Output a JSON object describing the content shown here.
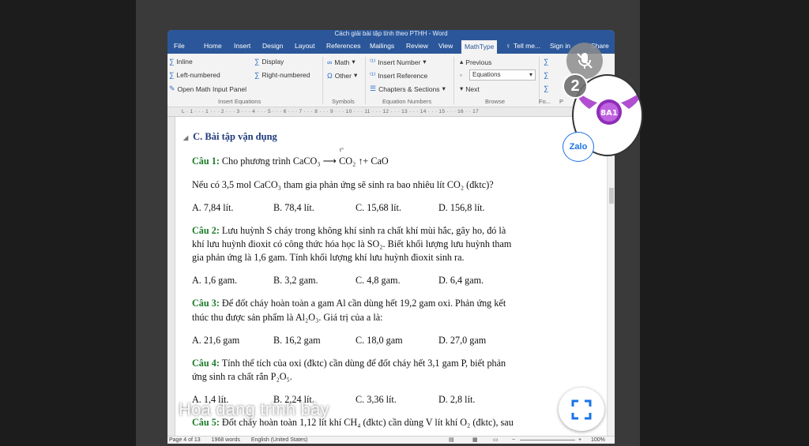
{
  "app": {
    "window_title": "Cách giải bài tập tính theo PTHH - Word"
  },
  "ribbon_tabs": [
    "File",
    "Home",
    "Insert",
    "Design",
    "Layout",
    "References",
    "Mailings",
    "Review",
    "View",
    "MathType",
    "Tell me...",
    "Sign in",
    "Share"
  ],
  "ribbon": {
    "insert_equations": {
      "inline": "Inline",
      "display": "Display",
      "left_numbered": "Left-numbered",
      "right_numbered": "Right-numbered",
      "open_panel": "Open Math Input Panel",
      "group_label": "Insert Equations"
    },
    "symbols": {
      "math": "Math",
      "other": "Other",
      "group_label": "Symbols"
    },
    "equation_numbers": {
      "insert_number": "Insert Number",
      "insert_reference": "Insert Reference",
      "chapters_sections": "Chapters & Sections",
      "group_label": "Equation Numbers"
    },
    "browse": {
      "previous": "Previous",
      "equations_value": "Equations",
      "next": "Next",
      "group_label": "Browse"
    },
    "fo_label": "Fo...",
    "p_label": "P"
  },
  "ruler_text": "L · 1 · · · 1 · · · 2 · · · 3 · · · 4 · · · 5 · · · 6 · · · 7 · · · 8 · · · 9 · · · 10 · · · 11 · · · 12 · · · 13 · · · 14 · · · 15 · · · 16 · · 17",
  "document": {
    "heading": "C. Bài tập vận dụng",
    "q1": {
      "label": "Câu 1:",
      "text": " Cho phương trình CaCO₃ ⟶ CO₂ ↑+ CaO",
      "arrow_note": "t°",
      "line2": "Nếu có 3,5 mol CaCO₃ tham gia phản ứng sẽ sinh ra bao nhiêu lít CO₂ (đktc)?",
      "options": [
        "A. 7,84 lít.",
        "B. 78,4 lít.",
        "C. 15,68 lít.",
        "D. 156,8 lít."
      ]
    },
    "q2": {
      "label": "Câu 2:",
      "line1": " Lưu huỳnh S cháy trong không khí sinh ra chất khí mùi hắc, gây ho, đó là",
      "line2": "khí lưu huỳnh đioxit có công thức hóa học là SO₂. Biết khối lượng lưu huỳnh tham",
      "line3": "gia phản ứng là 1,6 gam. Tính khối lượng khí lưu huỳnh đioxit sinh ra.",
      "options": [
        "A. 1,6 gam.",
        "B. 3,2 gam.",
        "C. 4,8 gam.",
        "D. 6,4 gam."
      ]
    },
    "q3": {
      "label": "Câu 3:",
      "line1": " Để đốt cháy hoàn toàn a gam Al cần dùng hết 19,2 gam oxi. Phản ứng kết",
      "line2": "thúc thu được sản phẩm là Al₂O₃. Giá trị của a là:",
      "options": [
        "A. 21,6 gam",
        "B. 16,2 gam",
        "C. 18,0 gam",
        "D. 27,0 gam"
      ]
    },
    "q4": {
      "label": "Câu 4:",
      "line1": " Tính thể tích của oxi (đktc) cần dùng để đốt cháy hết 3,1 gam P, biết phản",
      "line2": "ứng sinh ra chất rắn P₂O₅.",
      "options": [
        "A. 1,4 lít.",
        "B. 2,24 lít.",
        "C. 3,36 lít.",
        "D. 2,8 lít."
      ]
    },
    "q5": {
      "label": "Câu 5:",
      "line1": " Đốt cháy hoàn toàn 1,12 lít khí CH₄ (đktc) cần dùng V lít khí O₂ (đktc), sau"
    }
  },
  "status_bar": {
    "page": "Page 4 of 13",
    "words": "1968 words",
    "language": "English (United States)",
    "zoom": "100%"
  },
  "overlay": {
    "caption": "Hoa đang trình bày",
    "participant_count": "2",
    "zalo_label": "Zalo",
    "avatar_badge": "8A1"
  },
  "colors": {
    "word_blue": "#2b579a",
    "question_green": "#1d7a2a",
    "heading_blue": "#1f3a7a",
    "zalo_blue": "#1a73e8"
  }
}
